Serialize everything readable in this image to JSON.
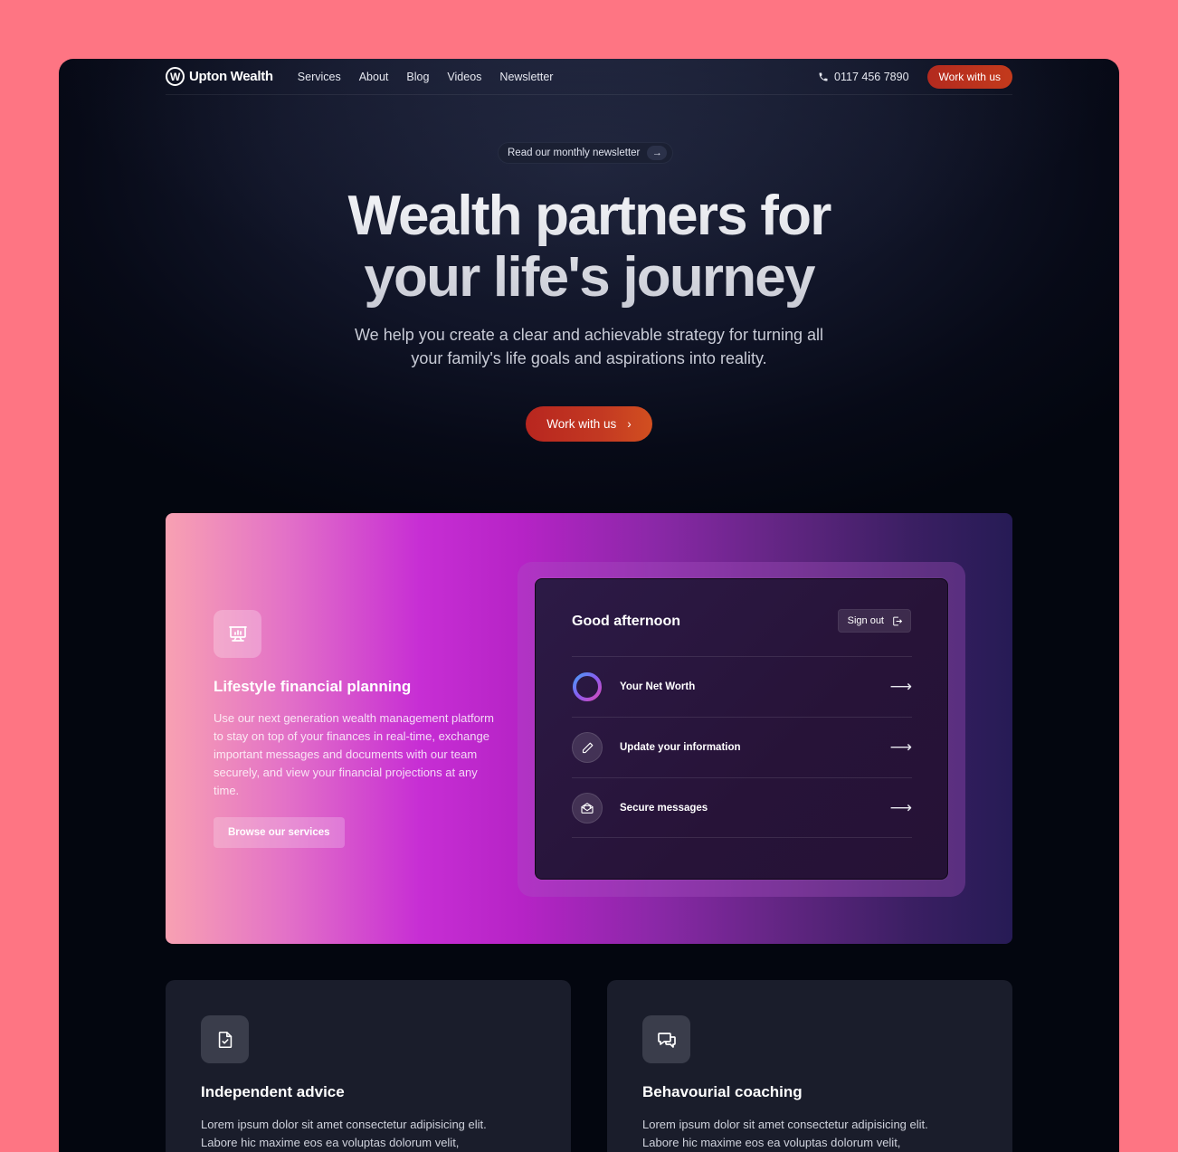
{
  "nav": {
    "brand": "Upton Wealth",
    "brand_mark": "W",
    "links": [
      "Services",
      "About",
      "Blog",
      "Videos",
      "Newsletter"
    ],
    "phone": "0117 456 7890",
    "cta": "Work with us"
  },
  "hero": {
    "pill": "Read our monthly newsletter",
    "title_line1": "Wealth partners for",
    "title_line2": "your life's journey",
    "subtitle_line1": "We help you create a clear and achievable strategy for turning all",
    "subtitle_line2": "your family's life goals and aspirations into reality.",
    "cta": "Work with us",
    "cta_arrow": "›"
  },
  "feature": {
    "icon": "presentation-chart-icon",
    "title": "Lifestyle financial planning",
    "text": "Use our next generation wealth management platform to stay on top of your finances in real-time, exchange important messages and documents with our team securely, and view your financial projections at any time.",
    "button": "Browse our services",
    "dashboard": {
      "greeting": "Good afternoon",
      "sign_out": "Sign out",
      "rows": [
        {
          "label": "Your Net Worth",
          "icon": "progress-ring-icon"
        },
        {
          "label": "Update your information",
          "icon": "pencil-icon"
        },
        {
          "label": "Secure messages",
          "icon": "envelope-open-icon"
        }
      ],
      "arrow": "⟶"
    }
  },
  "cards": [
    {
      "icon": "document-check-icon",
      "title": "Independent advice",
      "text_line1": "Lorem ipsum dolor sit amet consectetur adipisicing elit.",
      "text_line2": "Labore hic maxime eos ea voluptas dolorum velit,"
    },
    {
      "icon": "chat-bubbles-icon",
      "title": "Behavourial coaching",
      "text_line1": "Lorem ipsum dolor sit amet consectetur adipisicing elit.",
      "text_line2": "Labore hic maxime eos ea voluptas dolorum velit,"
    }
  ],
  "colors": {
    "page_background": "#fe7583",
    "accent": "#c33922",
    "frame": "#070a17"
  }
}
